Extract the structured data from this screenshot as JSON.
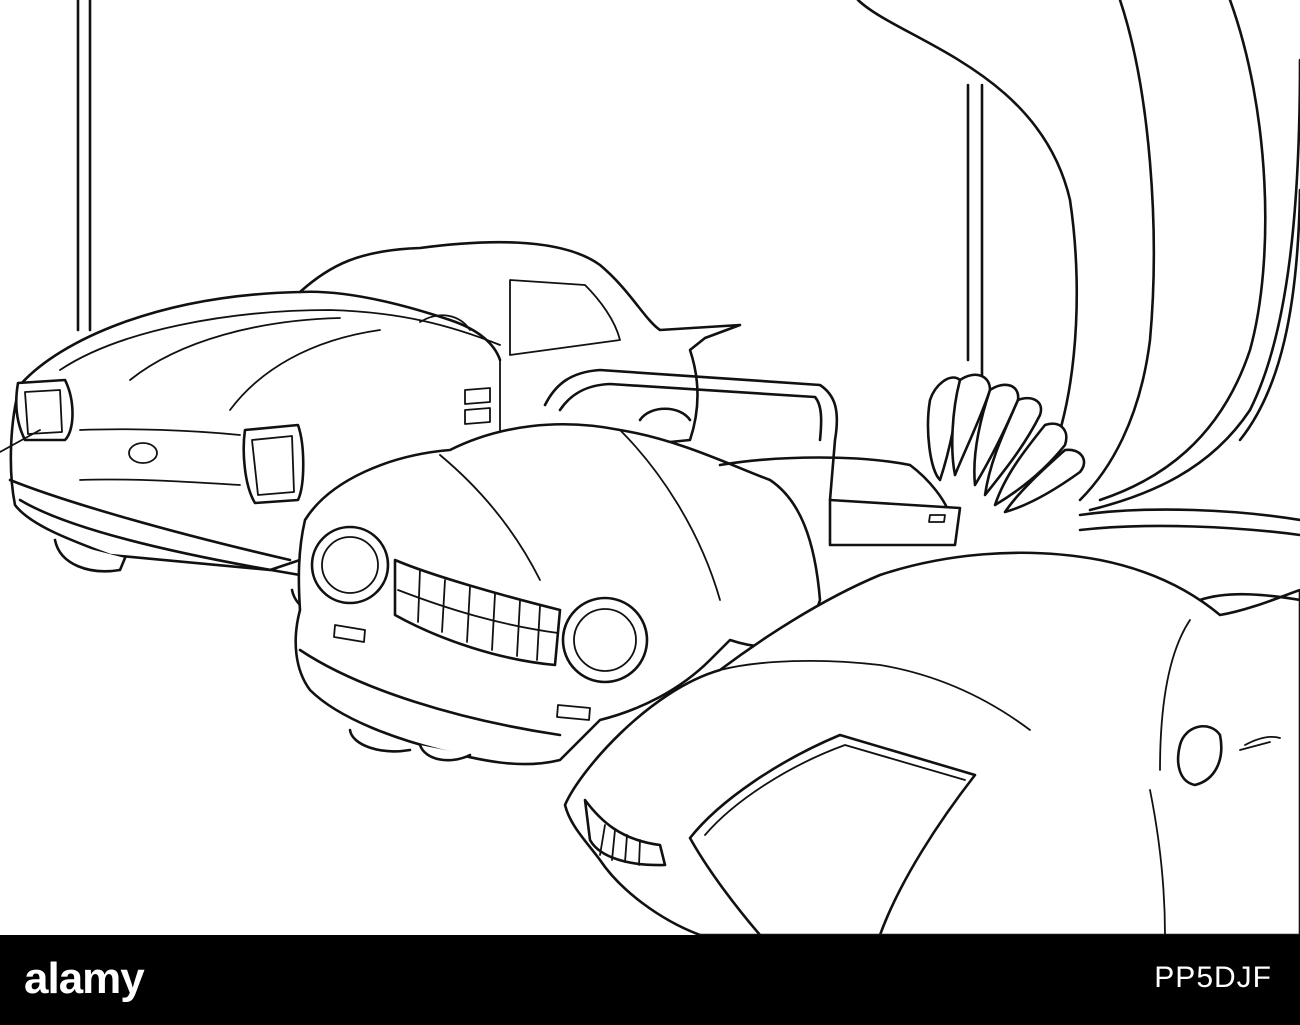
{
  "brand": {
    "logo_text": "alamy",
    "logo_icon": "alamy-logo",
    "text_color": "#ffffff",
    "bar_color": "#000000"
  },
  "image_id": "PP5DJF",
  "colors": {
    "line_art": "#111111",
    "background": "#ffffff"
  }
}
